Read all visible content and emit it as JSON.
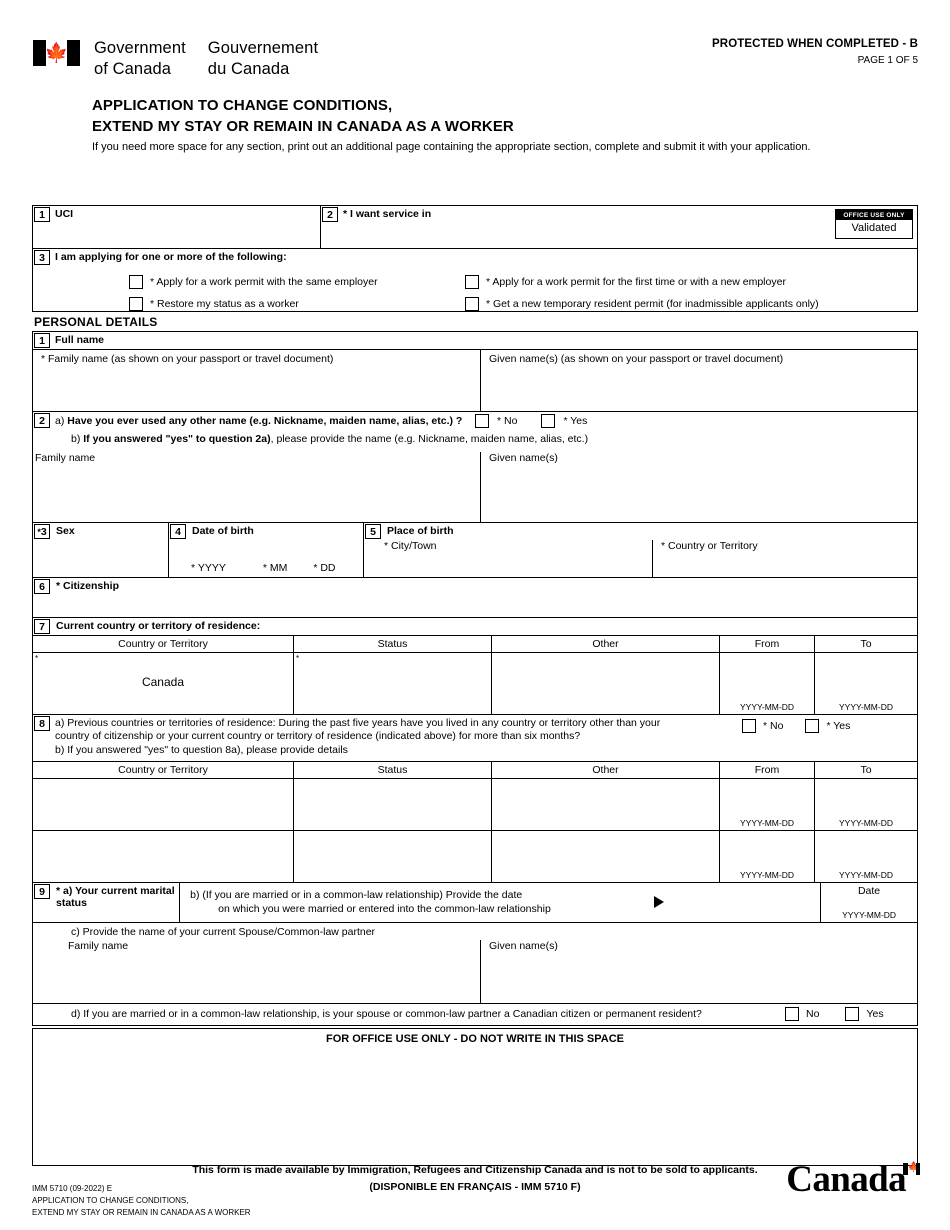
{
  "header": {
    "gov_en_l1": "Government",
    "gov_en_l2": "of Canada",
    "gov_fr_l1": "Gouvernement",
    "gov_fr_l2": "du Canada",
    "flag_icon": "canada-flag-icon",
    "protected": "PROTECTED WHEN COMPLETED - B",
    "page_of": "PAGE 1 OF 5",
    "title_line1": "APPLICATION TO CHANGE CONDITIONS,",
    "title_line2": "EXTEND MY STAY OR REMAIN IN CANADA AS A WORKER",
    "intro": "If you need more space for any section, print out an additional page containing the appropriate section, complete and submit it with your application."
  },
  "office_use": {
    "caption": "OFFICE USE ONLY",
    "value": "Validated"
  },
  "top": {
    "q1_num": "1",
    "q1_label": "UCI",
    "q1_value": "",
    "q2_num": "2",
    "q2_label": "* I want service in",
    "q2_value": "",
    "q3_num": "3",
    "q3_label": "I am applying for one or more of the following:",
    "options": [
      "* Apply for a work permit with the same employer",
      "* Apply for a work permit for the first time or with a new employer",
      "*  Restore my status as a worker",
      "* Get a new temporary resident permit (for inadmissible applicants only)"
    ]
  },
  "personal": {
    "section_title": "PERSONAL DETAILS",
    "q1_num": "1",
    "q1_label": "Full name",
    "q1_family_label": "* Family name (as shown on your passport or travel document)",
    "q1_given_label": "Given name(s) (as shown on your passport or travel document)",
    "q1_family_value": "",
    "q1_given_value": "",
    "q2_num": "2",
    "q2a_label_a": "a) ",
    "q2a_label_b": "Have you ever used any other name (e.g. Nickname, maiden name, alias, etc.) ?",
    "q2a_no": "* No",
    "q2a_yes": "* Yes",
    "q2b_prefix": "b) ",
    "q2b_bold": "If you answered \"yes\" to question 2a)",
    "q2b_rest": ", please provide the name (e.g. Nickname, maiden name, alias, etc.)",
    "q2b_family_label": "Family name",
    "q2b_given_label": "Given name(s)",
    "q2b_family_value": "",
    "q2b_given_value": "",
    "q3_num": "3",
    "q3_label": "Sex",
    "q3_value": "",
    "q4_num": "4",
    "q4_label": "Date of birth",
    "q4_yyyy": "* YYYY",
    "q4_mm": "* MM",
    "q4_dd": "* DD",
    "q4_value": "",
    "q5_num": "5",
    "q5_label": "Place of birth",
    "q5_city_label": "* City/Town",
    "q5_country_label": "* Country or Territory",
    "q5_city_value": "",
    "q5_country_value": "",
    "q6_num": "6",
    "q6_label": "* Citizenship",
    "q6_value": ""
  },
  "residence": {
    "q7_num": "7",
    "q7_label": "Current country or territory of residence:",
    "columns": [
      "Country or Territory",
      "Status",
      "Other",
      "From",
      "To"
    ],
    "date_hint": "YYYY-MM-DD",
    "current_row": {
      "country": "Canada",
      "status": "",
      "other": "",
      "from": "",
      "to": ""
    },
    "q8_num": "8",
    "q8a_prefix": "a) ",
    "q8a_bold": "Previous countries or territories of residence:",
    "q8a_rest_line1": " During the past five years have you lived in any country or territory other than your",
    "q8a_rest_line2": "country of citizenship or your current country or territory of residence (indicated above) for more than six months?",
    "q8a_no": "* No",
    "q8a_yes": "* Yes",
    "q8b_prefix": "b) ",
    "q8b_bold": "If you answered \"yes\" to question 8a)",
    "q8b_rest": ", please provide details",
    "previous_rows": [
      {
        "country": "",
        "status": "",
        "other": "",
        "from": "",
        "to": ""
      },
      {
        "country": "",
        "status": "",
        "other": "",
        "from": "",
        "to": ""
      }
    ]
  },
  "marital": {
    "q9_num": "9",
    "q9a_label": "* a) Your current marital status",
    "q9a_value": "",
    "q9b_prefix": "b) ",
    "q9b_bold": "(If you are married or in a common-law relationship)",
    "q9b_rest_line1": " Provide the date",
    "q9b_line2": "on which you were married or entered into the common-law relationship",
    "q9b_date_label": "Date",
    "q9b_date_hint": "YYYY-MM-DD",
    "q9b_date_value": "",
    "q9c_label": "c) Provide the name of your current Spouse/Common-law partner",
    "q9c_family_label": "Family name",
    "q9c_given_label": "Given name(s)",
    "q9c_family_value": "",
    "q9c_given_value": "",
    "q9d_label": "d)  If you are married or in a common-law relationship, is your spouse or common-law partner a Canadian citizen or permanent resident?",
    "q9d_no": "No",
    "q9d_yes": "Yes"
  },
  "office_block": {
    "label": "FOR OFFICE USE ONLY - DO NOT WRITE IN THIS SPACE"
  },
  "footer": {
    "line1": "This form is made available by Immigration, Refugees and Citizenship Canada and is not to be sold to applicants.",
    "line2": "(DISPONIBLE EN FRANÇAIS - IMM 5710 F)",
    "imm_line1": "IMM 5710 (09-2022) E",
    "imm_line2": "APPLICATION TO CHANGE CONDITIONS,",
    "imm_line3": "EXTEND MY STAY OR REMAIN IN CANADA AS A WORKER",
    "wordmark": "Canada"
  }
}
